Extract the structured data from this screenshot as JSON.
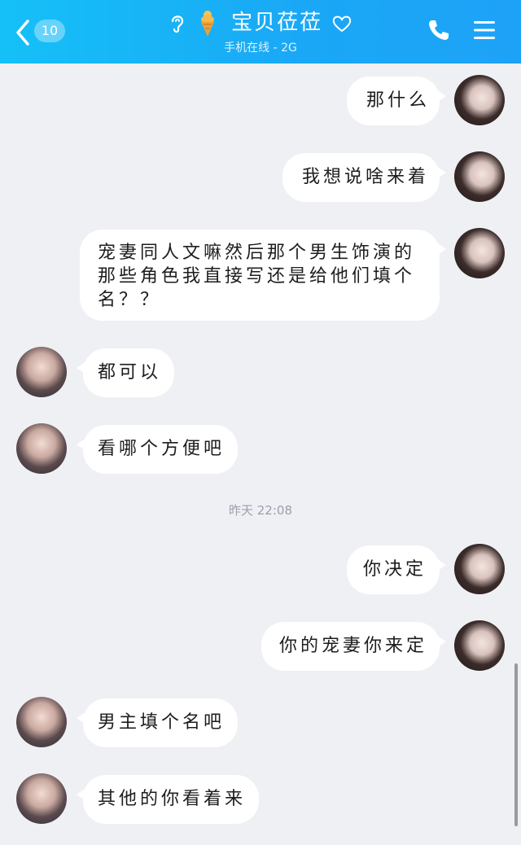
{
  "header": {
    "unread_count": "10",
    "contact_name": "宝贝莅莅",
    "status": "手机在线 - 2G"
  },
  "messages": [
    {
      "side": "right",
      "text": "那什么"
    },
    {
      "side": "right",
      "text": "我想说啥来着"
    },
    {
      "side": "right",
      "text": "宠妻同人文嘛然后那个男生饰演的那些角色我直接写还是给他们填个名？？"
    },
    {
      "side": "left",
      "text": "都可以"
    },
    {
      "side": "left",
      "text": "看哪个方便吧"
    },
    {
      "side": "right",
      "text": "你决定"
    },
    {
      "side": "right",
      "text": "你的宠妻你来定"
    },
    {
      "side": "left",
      "text": "男主填个名吧"
    },
    {
      "side": "left",
      "text": "其他的你看着来"
    }
  ],
  "timestamp": "昨天 22:08",
  "colors": {
    "header_start": "#15c0f7",
    "header_end": "#1ea2f7",
    "bg": "#eef0f4",
    "bubble": "#ffffff"
  }
}
